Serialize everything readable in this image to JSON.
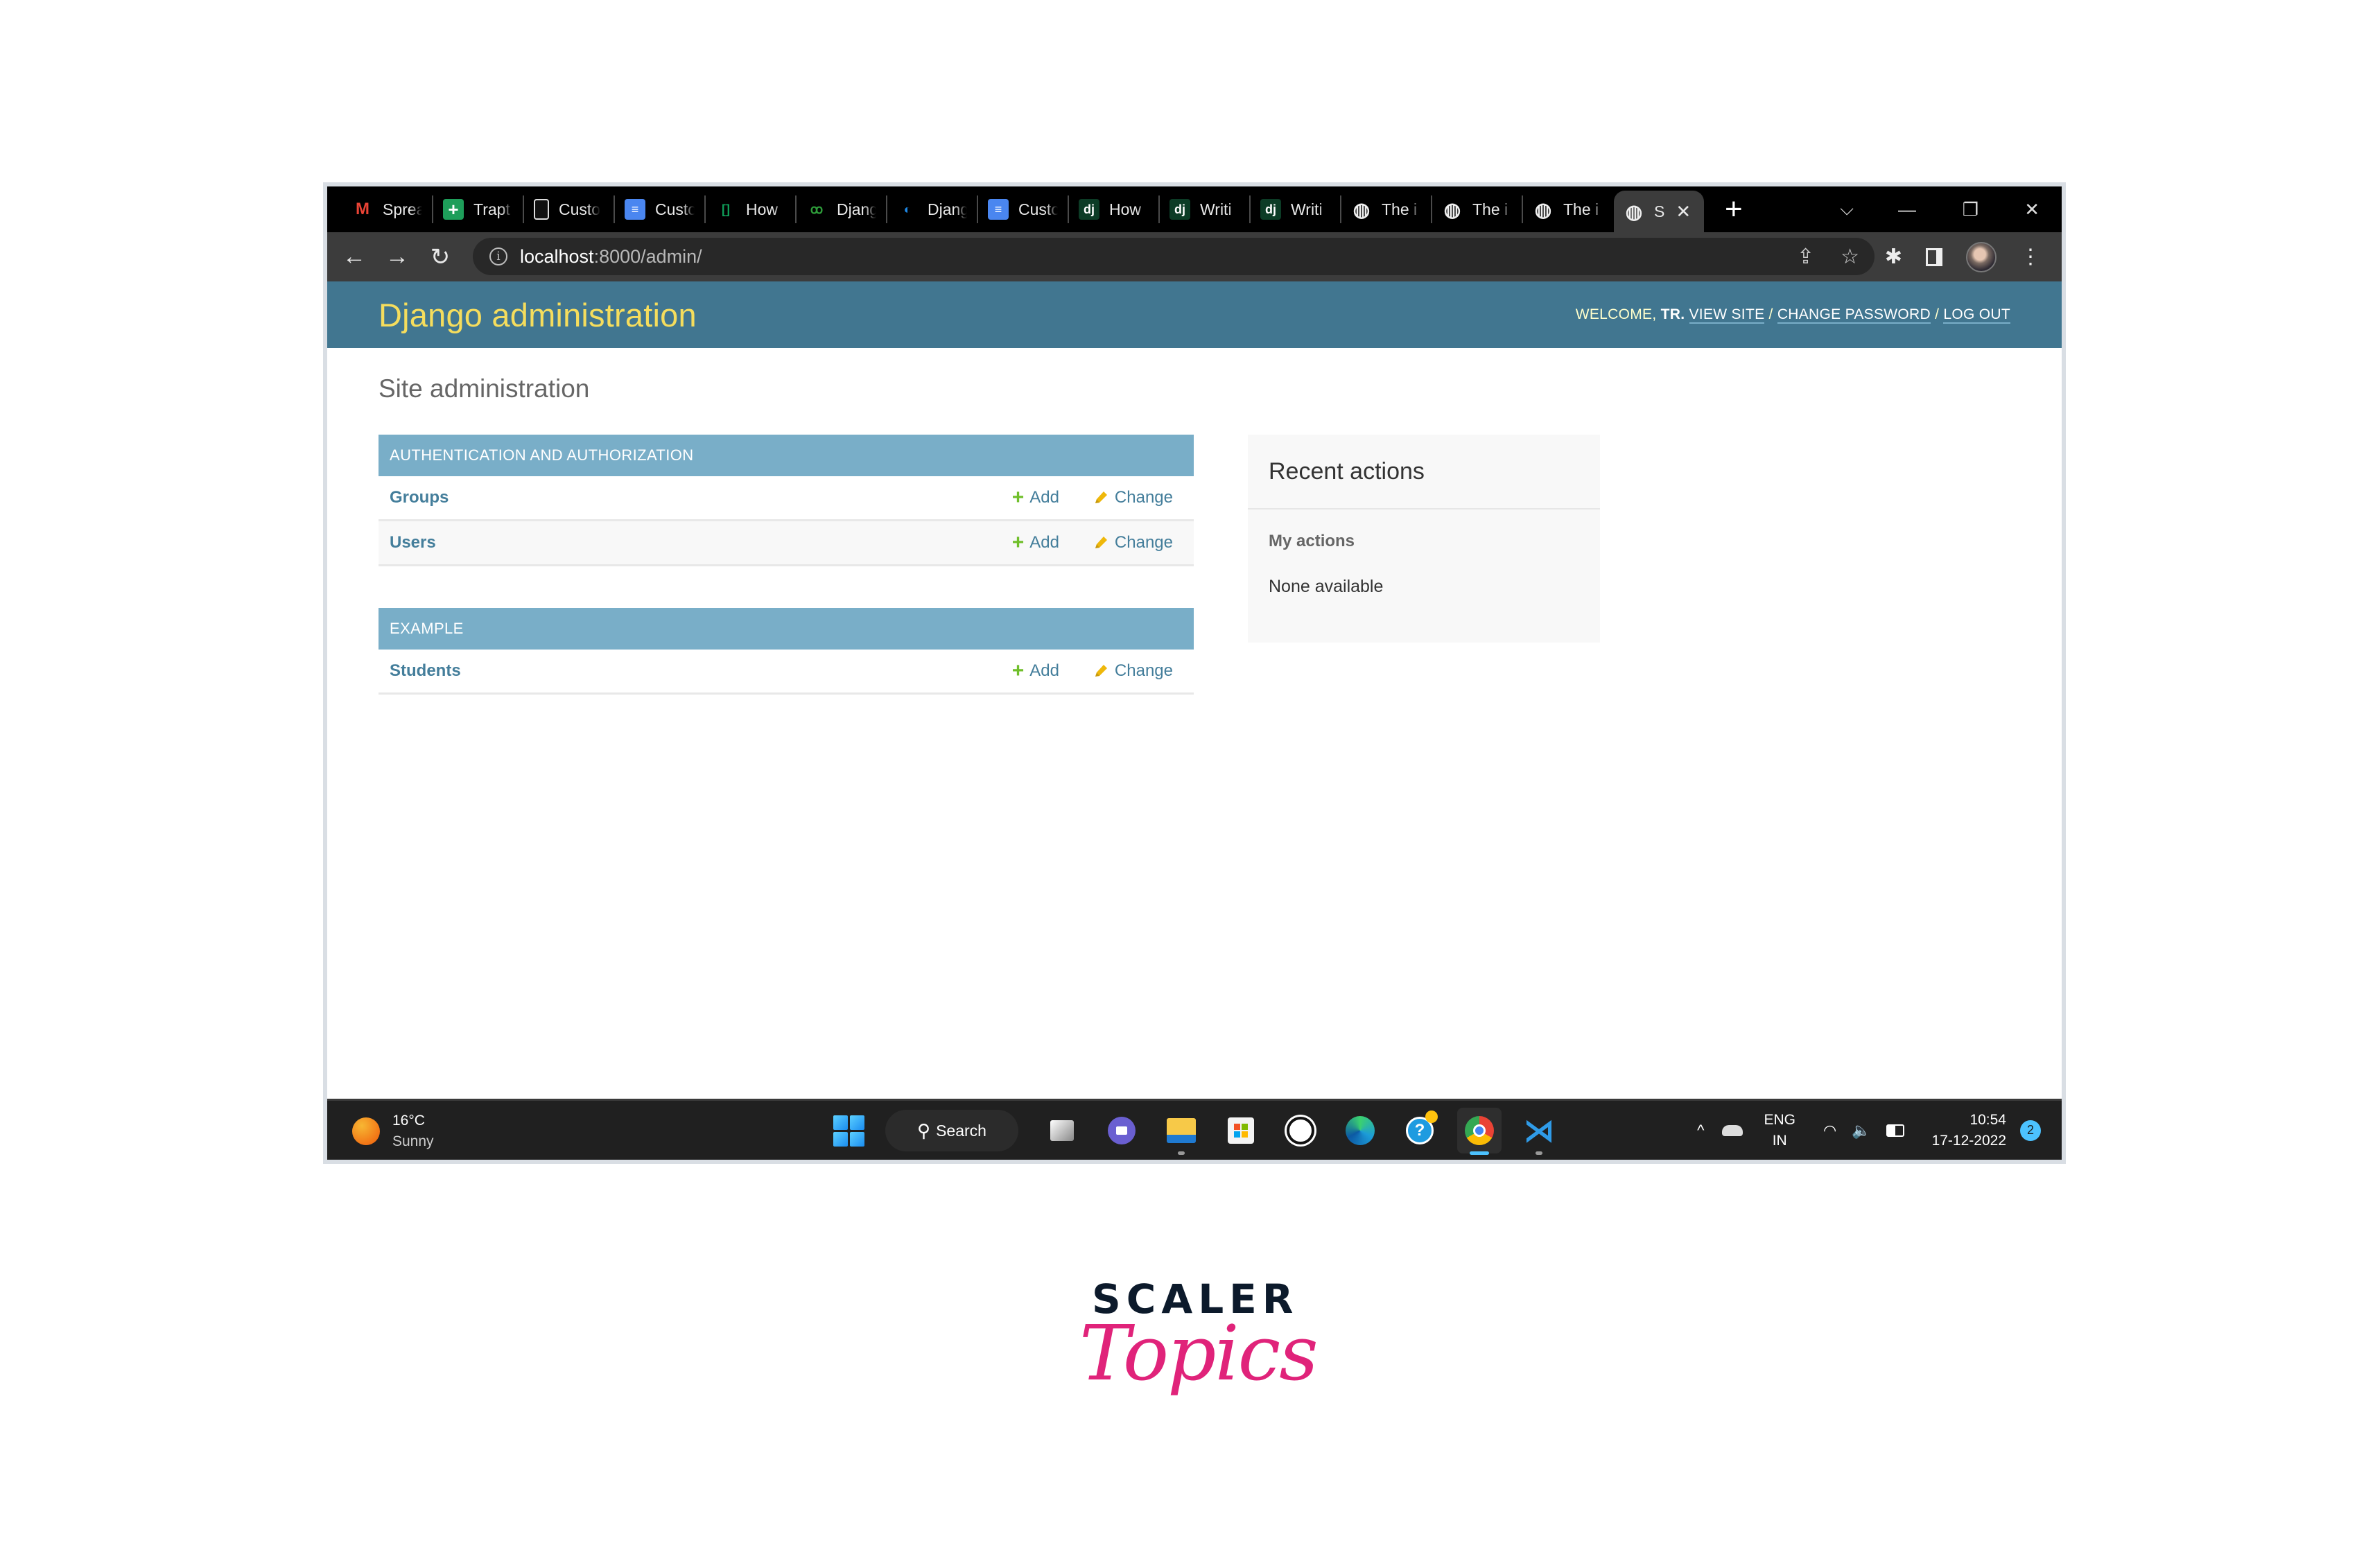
{
  "browser": {
    "tabs": [
      {
        "title": "Sprea",
        "icon": "gmail-icon",
        "color": "#ea4335"
      },
      {
        "title": "Trapt",
        "icon": "sheets-icon",
        "color": "#1e9e5a"
      },
      {
        "title": "Custo",
        "icon": "document-icon",
        "color": "#444444"
      },
      {
        "title": "Custo",
        "icon": "google-docs-icon",
        "color": "#4a86f0"
      },
      {
        "title": "How",
        "icon": "geeksforgeeks-icon",
        "color": "#0f9d58"
      },
      {
        "title": "Djang",
        "icon": "django-alt-icon",
        "color": "#2e7d32"
      },
      {
        "title": "Djang",
        "icon": "pycharm-icon",
        "color": "#1565c0"
      },
      {
        "title": "Custo",
        "icon": "google-docs-icon",
        "color": "#4a86f0"
      },
      {
        "title": "How",
        "icon": "django-icon",
        "color": "#0c3c26"
      },
      {
        "title": "Writi",
        "icon": "django-icon",
        "color": "#0c3c26"
      },
      {
        "title": "Writi",
        "icon": "django-icon",
        "color": "#0c3c26"
      },
      {
        "title": "The i",
        "icon": "globe-icon",
        "color": "#444444"
      },
      {
        "title": "The i",
        "icon": "globe-icon",
        "color": "#444444"
      },
      {
        "title": "The i",
        "icon": "globe-icon",
        "color": "#444444"
      }
    ],
    "active_tab": {
      "title": "S",
      "icon": "globe-icon"
    },
    "new_tab_label": "+",
    "url_host": "localhost",
    "url_rest": ":8000/admin/"
  },
  "admin": {
    "branding": "Django administration",
    "welcome": "Welcome,",
    "username": "TR.",
    "view_site": "View site",
    "change_password": "Change password",
    "log_out": "Log out",
    "separator": "/",
    "site_title": "Site administration",
    "modules": [
      {
        "caption": "Authentication and Authorization",
        "models": [
          {
            "name": "Groups",
            "add": "Add",
            "change": "Change"
          },
          {
            "name": "Users",
            "add": "Add",
            "change": "Change"
          }
        ]
      },
      {
        "caption": "Example",
        "models": [
          {
            "name": "Students",
            "add": "Add",
            "change": "Change"
          }
        ]
      }
    ],
    "recent_actions": {
      "title": "Recent actions",
      "subtitle": "My actions",
      "empty": "None available"
    },
    "colors": {
      "header": "#417690",
      "branding": "#f5dd5d",
      "module_caption": "#79aec8",
      "link": "#447e9b",
      "add": "#70bf2b",
      "change": "#efb80b"
    }
  },
  "taskbar": {
    "temperature": "16°C",
    "condition": "Sunny",
    "search_label": "Search",
    "language": "ENG",
    "region": "IN",
    "time": "10:54",
    "date": "17-12-2022",
    "notifications": "2"
  },
  "watermark": {
    "line1": "SCALER",
    "line2": "Topics"
  }
}
